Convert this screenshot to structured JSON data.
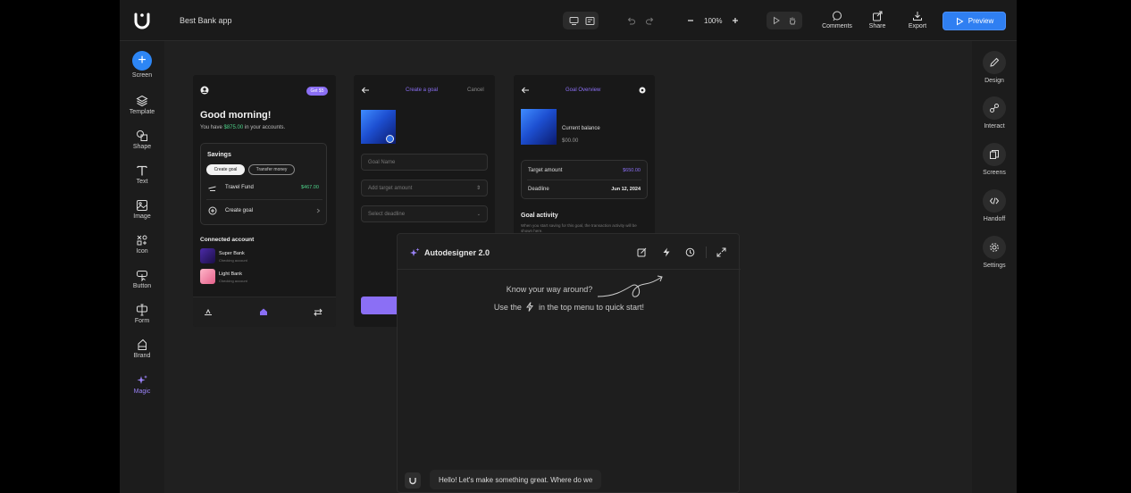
{
  "app": {
    "project_title": "Best Bank app",
    "zoom": "100%",
    "comments_label": "Comments",
    "share_label": "Share",
    "export_label": "Export",
    "preview_label": "Preview",
    "accent_color": "#2f7ff2"
  },
  "left_toolbar": {
    "items": [
      {
        "label": "Screen",
        "icon": "plus-icon"
      },
      {
        "label": "Template",
        "icon": "layers-icon"
      },
      {
        "label": "Shape",
        "icon": "shape-icon"
      },
      {
        "label": "Text",
        "icon": "text-icon"
      },
      {
        "label": "Image",
        "icon": "image-icon"
      },
      {
        "label": "Icon",
        "icon": "icon-grid-icon"
      },
      {
        "label": "Button",
        "icon": "button-icon"
      },
      {
        "label": "Form",
        "icon": "form-icon"
      },
      {
        "label": "Brand",
        "icon": "brand-icon"
      },
      {
        "label": "Magic",
        "icon": "sparkle-icon"
      }
    ]
  },
  "right_toolbar": {
    "items": [
      {
        "label": "Design",
        "icon": "pencil-icon"
      },
      {
        "label": "Interact",
        "icon": "link-icon"
      },
      {
        "label": "Screens",
        "icon": "screens-icon"
      },
      {
        "label": "Handoff",
        "icon": "code-icon"
      },
      {
        "label": "Settings",
        "icon": "gear-icon"
      }
    ]
  },
  "screen1": {
    "badge": "Get $5",
    "greeting": "Good morning!",
    "balance_prefix": "You have ",
    "balance_amount": "$875.00",
    "balance_suffix": " in your accounts.",
    "savings_title": "Savings",
    "create_goal_chip": "Create goal",
    "transfer_chip": "Transfer money",
    "travel_fund_label": "Travel Fund",
    "travel_fund_amount": "$467.00",
    "create_goal_label": "Create goal",
    "connected_title": "Connected account",
    "accounts": [
      {
        "name": "Super Bank",
        "sub": "Checking account"
      },
      {
        "name": "Light Bank",
        "sub": "Checking account"
      }
    ]
  },
  "screen2": {
    "title": "Create a goal",
    "cancel": "Cancel",
    "goal_name_placeholder": "Goal Name",
    "target_placeholder": "Add target amount",
    "deadline_placeholder": "Select deadline"
  },
  "screen3": {
    "title": "Goal Overview",
    "current_balance_label": "Current balance",
    "current_balance_value": "$00.00",
    "target_label": "Target amount",
    "target_value": "$650.00",
    "deadline_label": "Deadline",
    "deadline_value": "Jun 12, 2024",
    "activity_title": "Goal activity",
    "activity_text": "When you start saving for this goal, the transaction activity will be shown here."
  },
  "autodesigner": {
    "title": "Autodesigner 2.0",
    "hint_line1": "Know your way around?",
    "hint_line2_pre": "Use the",
    "hint_line2_post": "in the top menu to quick start!",
    "chat_message": "Hello! Let's make something great. Where do we"
  }
}
